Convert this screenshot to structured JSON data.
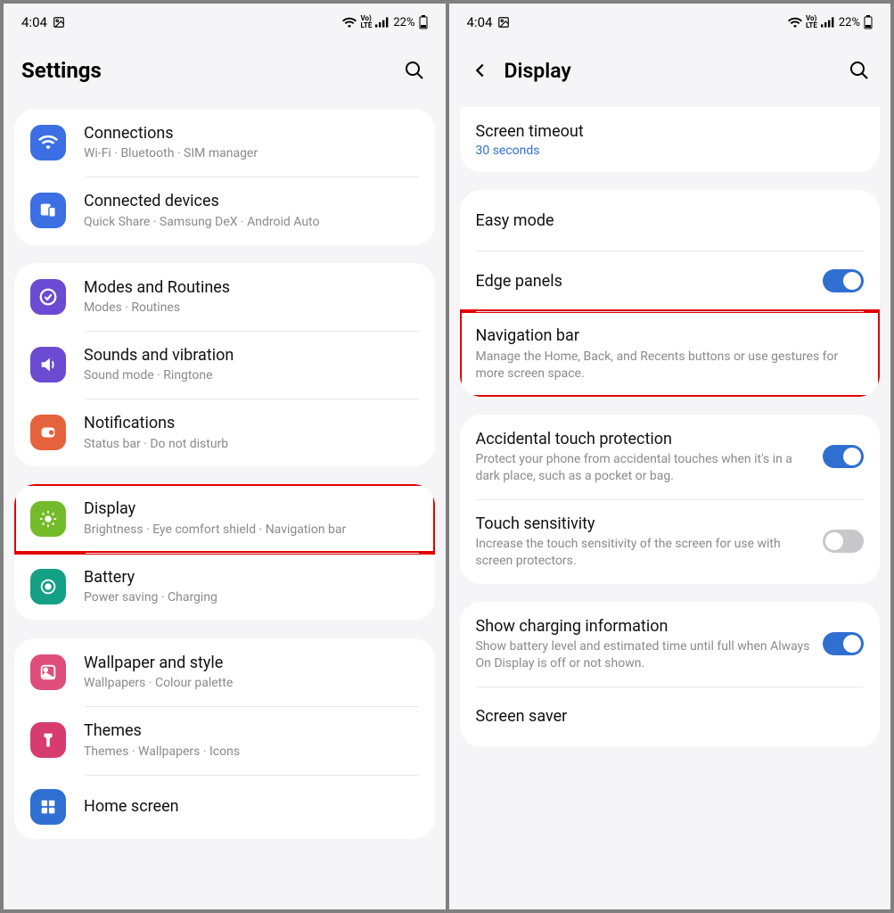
{
  "statusbar": {
    "time": "4:04",
    "battery_pct": "22%"
  },
  "left": {
    "title": "Settings",
    "groups": [
      {
        "items": [
          {
            "id": "connections",
            "title": "Connections",
            "sub": "Wi-Fi · Bluetooth · SIM manager",
            "iconClass": "ic-blue",
            "icon": "wifi"
          },
          {
            "id": "connected-devices",
            "title": "Connected devices",
            "sub": "Quick Share · Samsung DeX · Android Auto",
            "iconClass": "ic-blue",
            "icon": "devices"
          }
        ]
      },
      {
        "items": [
          {
            "id": "modes",
            "title": "Modes and Routines",
            "sub": "Modes · Routines",
            "iconClass": "ic-purple",
            "icon": "check"
          },
          {
            "id": "sounds",
            "title": "Sounds and vibration",
            "sub": "Sound mode · Ringtone",
            "iconClass": "ic-purple",
            "icon": "sound"
          },
          {
            "id": "notifications",
            "title": "Notifications",
            "sub": "Status bar · Do not disturb",
            "iconClass": "ic-orange",
            "icon": "notif"
          }
        ]
      },
      {
        "items": [
          {
            "id": "display",
            "title": "Display",
            "sub": "Brightness · Eye comfort shield · Navigation bar",
            "iconClass": "ic-green",
            "icon": "sun",
            "highlight": true
          },
          {
            "id": "battery",
            "title": "Battery",
            "sub": "Power saving · Charging",
            "iconClass": "ic-teal",
            "icon": "battery"
          }
        ]
      },
      {
        "items": [
          {
            "id": "wallpaper",
            "title": "Wallpaper and style",
            "sub": "Wallpapers · Colour palette",
            "iconClass": "ic-pink",
            "icon": "image"
          },
          {
            "id": "themes",
            "title": "Themes",
            "sub": "Themes · Wallpapers · Icons",
            "iconClass": "ic-magenta",
            "icon": "theme"
          },
          {
            "id": "home",
            "title": "Home screen",
            "sub": "",
            "iconClass": "ic-blue2",
            "icon": "home"
          }
        ]
      }
    ]
  },
  "right": {
    "title": "Display",
    "groups": [
      {
        "partialTop": true,
        "items": [
          {
            "id": "screen-timeout",
            "title": "Screen timeout",
            "value": "30 seconds"
          }
        ]
      },
      {
        "items": [
          {
            "id": "easy-mode",
            "title": "Easy mode"
          },
          {
            "id": "edge-panels",
            "title": "Edge panels",
            "toggle": "on"
          },
          {
            "id": "nav-bar",
            "title": "Navigation bar",
            "sub": "Manage the Home, Back, and Recents buttons or use gestures for more screen space.",
            "highlight": true
          }
        ]
      },
      {
        "items": [
          {
            "id": "accidental",
            "title": "Accidental touch protection",
            "sub": "Protect your phone from accidental touches when it's in a dark place, such as a pocket or bag.",
            "toggle": "on"
          },
          {
            "id": "touch-sens",
            "title": "Touch sensitivity",
            "sub": "Increase the touch sensitivity of the screen for use with screen protectors.",
            "toggle": "off"
          }
        ]
      },
      {
        "items": [
          {
            "id": "charging-info",
            "title": "Show charging information",
            "sub": "Show battery level and estimated time until full when Always On Display is off or not shown.",
            "toggle": "on"
          },
          {
            "id": "screen-saver",
            "title": "Screen saver"
          }
        ]
      }
    ]
  }
}
